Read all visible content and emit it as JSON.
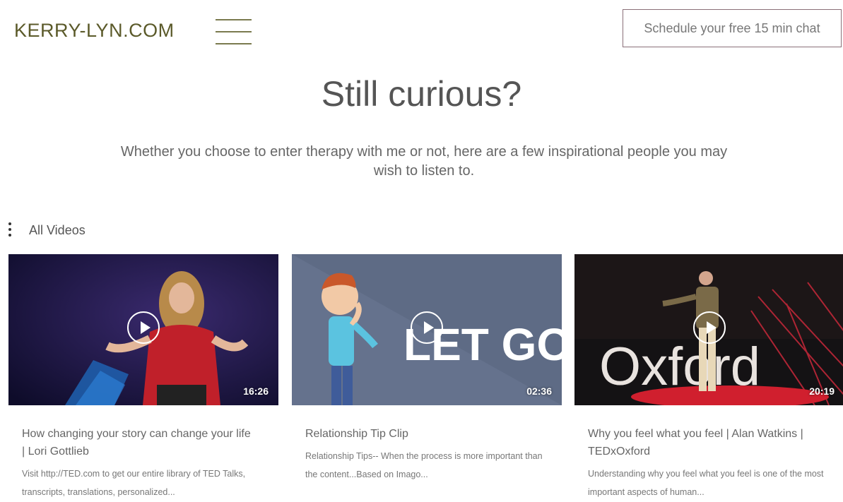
{
  "header": {
    "logo": "KERRY-LYN.COM",
    "cta_label": "Schedule your free 15 min chat"
  },
  "main": {
    "headline": "Still curious?",
    "subtitle": "Whether you choose to enter therapy with me or not, here are a few inspirational people you may wish to listen to."
  },
  "videos": {
    "section_label": "All Videos",
    "items": [
      {
        "title": "How changing your story can change your life | Lori Gottlieb",
        "description": "Visit http://TED.com to get our entire library of TED Talks, transcripts, translations, personalized...",
        "duration": "16:26"
      },
      {
        "title": "Relationship Tip Clip",
        "description": "Relationship Tips-- When the process is more important than the content...Based on Imago...",
        "duration": "02:36",
        "thumb_text": "LET GO"
      },
      {
        "title": "Why you feel what you feel | Alan Watkins | TEDxOxford",
        "description": "Understanding why you feel what you feel is one of the most important aspects of human...",
        "duration": "20:19",
        "thumb_text": "Oxford"
      }
    ]
  },
  "colors": {
    "logo": "#5b5a2a",
    "cta_border": "#8a6f78",
    "thumb2_bg": "#5e6b85"
  }
}
